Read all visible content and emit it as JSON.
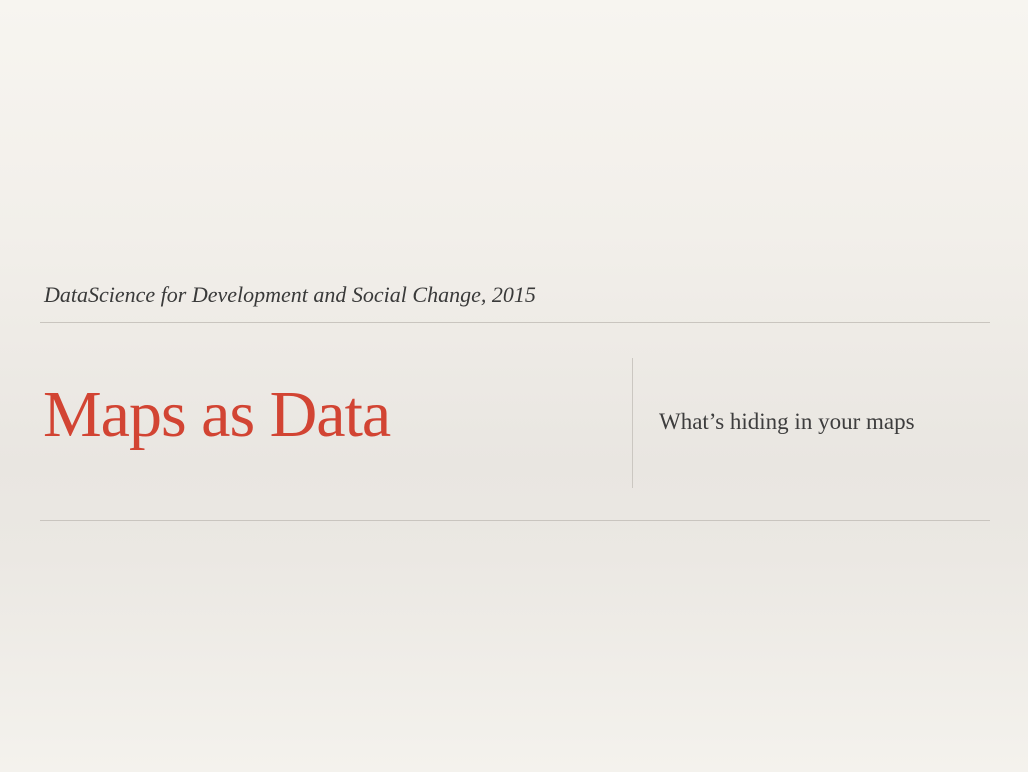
{
  "slide": {
    "event": "DataScience for Development and Social Change, 2015",
    "title": "Maps as Data",
    "tagline": "What’s hiding in your maps"
  },
  "colors": {
    "title": "#d24433",
    "text": "#3a3a3a",
    "rule": "#c9c5bf"
  }
}
